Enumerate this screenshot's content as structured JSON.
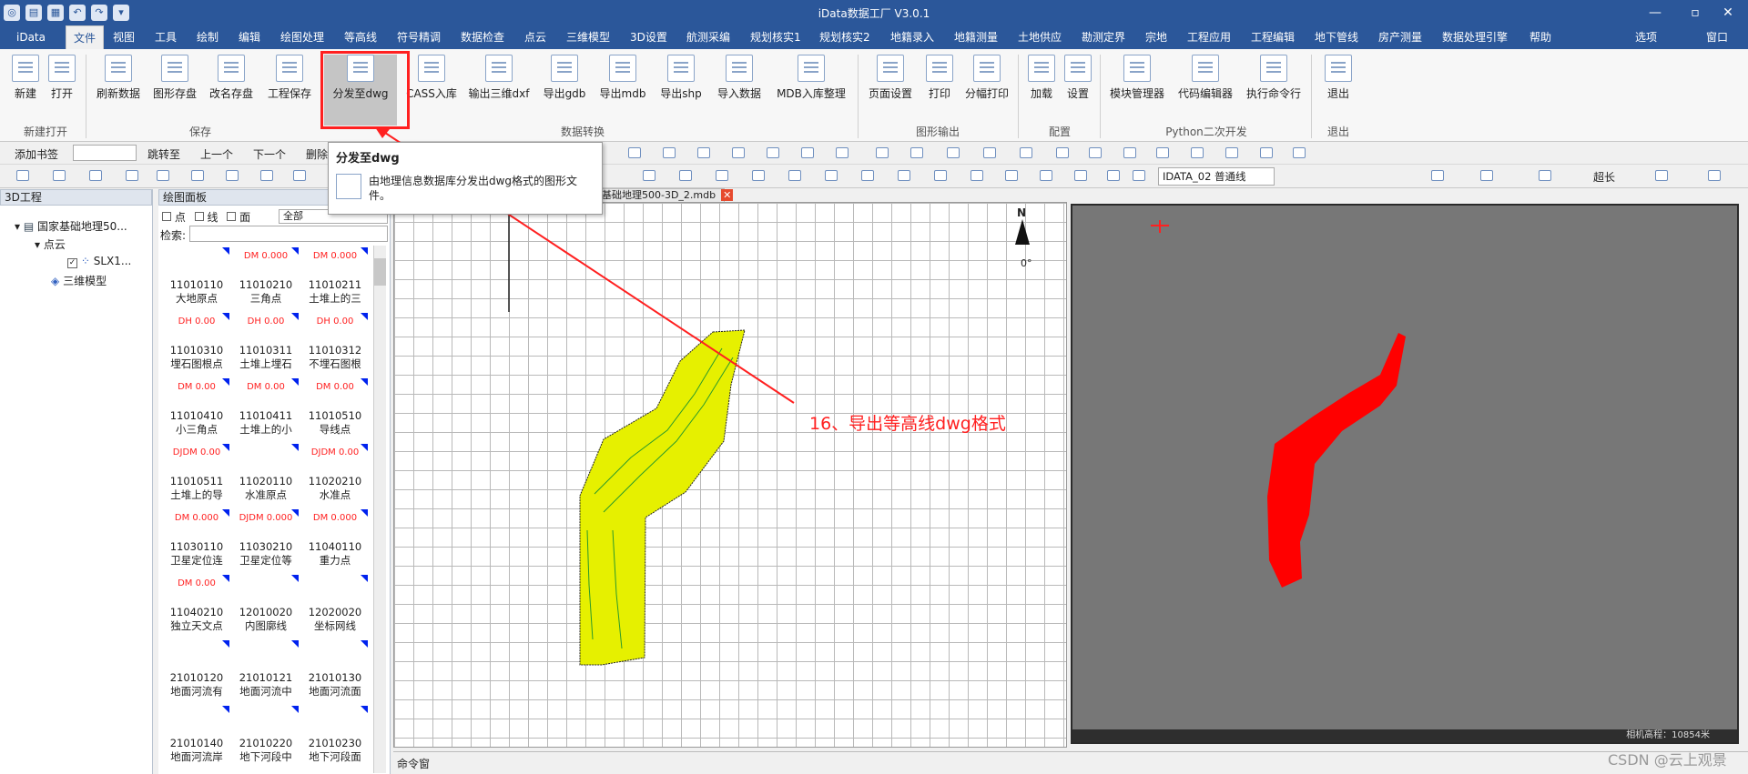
{
  "window": {
    "title": "iData数据工厂 V3.0.1",
    "controls": [
      "—",
      "▫",
      "✕"
    ]
  },
  "quick_access": [
    "◎",
    "▤",
    "▦",
    "↶",
    "↷",
    "▾"
  ],
  "menu": {
    "items": [
      "iData",
      "文件",
      "视图",
      "工具",
      "绘制",
      "编辑",
      "绘图处理",
      "等高线",
      "符号精调",
      "数据检查",
      "点云",
      "三维模型",
      "3D设置",
      "航测采编",
      "规划核实1",
      "规划核实2",
      "地籍录入",
      "地籍测量",
      "土地供应",
      "勘测定界",
      "宗地",
      "工程应用",
      "工程编辑",
      "地下管线",
      "房产测量",
      "数据处理引擎",
      "帮助"
    ],
    "right": [
      "选项",
      "窗口"
    ],
    "active": "文件"
  },
  "ribbon": {
    "buttons": [
      "新建",
      "打开",
      "刷新数据",
      "图形存盘",
      "改名存盘",
      "工程保存",
      "分发至dwg",
      "CASS入库",
      "输出三维dxf",
      "导出gdb",
      "导出mdb",
      "导出shp",
      "导入数据",
      "MDB入库整理",
      "页面设置",
      "打印",
      "分幅打印",
      "加载",
      "设置",
      "模块管理器",
      "代码编辑器",
      "执行命令行",
      "退出"
    ],
    "groups": [
      "新建打开",
      "保存",
      "数据转换",
      "图形输出",
      "配置",
      "Python二次开发",
      "退出"
    ]
  },
  "toolbar1": {
    "add_bookmark": "添加书签",
    "goto": "跳转至",
    "prev": "上一个",
    "next": "下一个",
    "delete": "删除"
  },
  "toolbar2": {
    "layer_combo": "IDATA_02 普通线",
    "extra": "超长"
  },
  "tooltip": {
    "title": "分发至dwg",
    "desc": "由地理信息数据库分发出dwg格式的图形文件。"
  },
  "panel_3d": {
    "title": "3D工程",
    "tree": [
      "国家基础地理50...",
      "点云",
      "SLX1...",
      "三维模型"
    ]
  },
  "panel_draw": {
    "title": "绘图面板",
    "filters": [
      "点",
      "线",
      "面"
    ],
    "filter_select": "全部",
    "search_label": "检索:",
    "symbols": [
      {
        "code": "11010110",
        "name": "大地原点",
        "tag": ""
      },
      {
        "code": "11010210",
        "name": "三角点",
        "tag": "DM 0.000"
      },
      {
        "code": "11010211",
        "name": "土堆上的三",
        "tag": "DM 0.000"
      },
      {
        "code": "11010310",
        "name": "埋石图根点",
        "tag": "DH 0.00"
      },
      {
        "code": "11010311",
        "name": "土堆上埋石",
        "tag": "DH 0.00"
      },
      {
        "code": "11010312",
        "name": "不埋石图根",
        "tag": "DH 0.00"
      },
      {
        "code": "11010410",
        "name": "小三角点",
        "tag": "DM 0.00"
      },
      {
        "code": "11010411",
        "name": "土堆上的小",
        "tag": "DM 0.00"
      },
      {
        "code": "11010510",
        "name": "导线点",
        "tag": "DM 0.00"
      },
      {
        "code": "11010511",
        "name": "土堆上的导",
        "tag": "DJDM 0.00"
      },
      {
        "code": "11020110",
        "name": "水准原点",
        "tag": ""
      },
      {
        "code": "11020210",
        "name": "水准点",
        "tag": "DJDM 0.00"
      },
      {
        "code": "11030110",
        "name": "卫星定位连",
        "tag": "DM 0.000"
      },
      {
        "code": "11030210",
        "name": "卫星定位等",
        "tag": "DJDM 0.000"
      },
      {
        "code": "11040110",
        "name": "重力点",
        "tag": "DM 0.000"
      },
      {
        "code": "11040210",
        "name": "独立天文点",
        "tag": "DM 0.00"
      },
      {
        "code": "12010020",
        "name": "内图廓线",
        "tag": ""
      },
      {
        "code": "12020020",
        "name": "坐标网线",
        "tag": ""
      },
      {
        "code": "21010120",
        "name": "地面河流有",
        "tag": ""
      },
      {
        "code": "21010121",
        "name": "地面河流中",
        "tag": ""
      },
      {
        "code": "21010130",
        "name": "地面河流面",
        "tag": ""
      },
      {
        "code": "21010140",
        "name": "地面河流岸",
        "tag": ""
      },
      {
        "code": "21010220",
        "name": "地下河段中",
        "tag": ""
      },
      {
        "code": "21010230",
        "name": "地下河段面",
        "tag": ""
      }
    ]
  },
  "document_tab": {
    "label": "基础地理500-3D_2.mdb"
  },
  "map": {
    "north": "N",
    "rotation": "0°",
    "annotation": "16、导出等高线dwg格式"
  },
  "view3d": {
    "status": "相机高程：10854米"
  },
  "command": {
    "label": "命令窗"
  },
  "watermark": "CSDN @云上观景",
  "colors": {
    "titlebar": "#2b579a",
    "highlight": "#ff2020",
    "contour": "#e6f000",
    "model": "#ff0000"
  }
}
